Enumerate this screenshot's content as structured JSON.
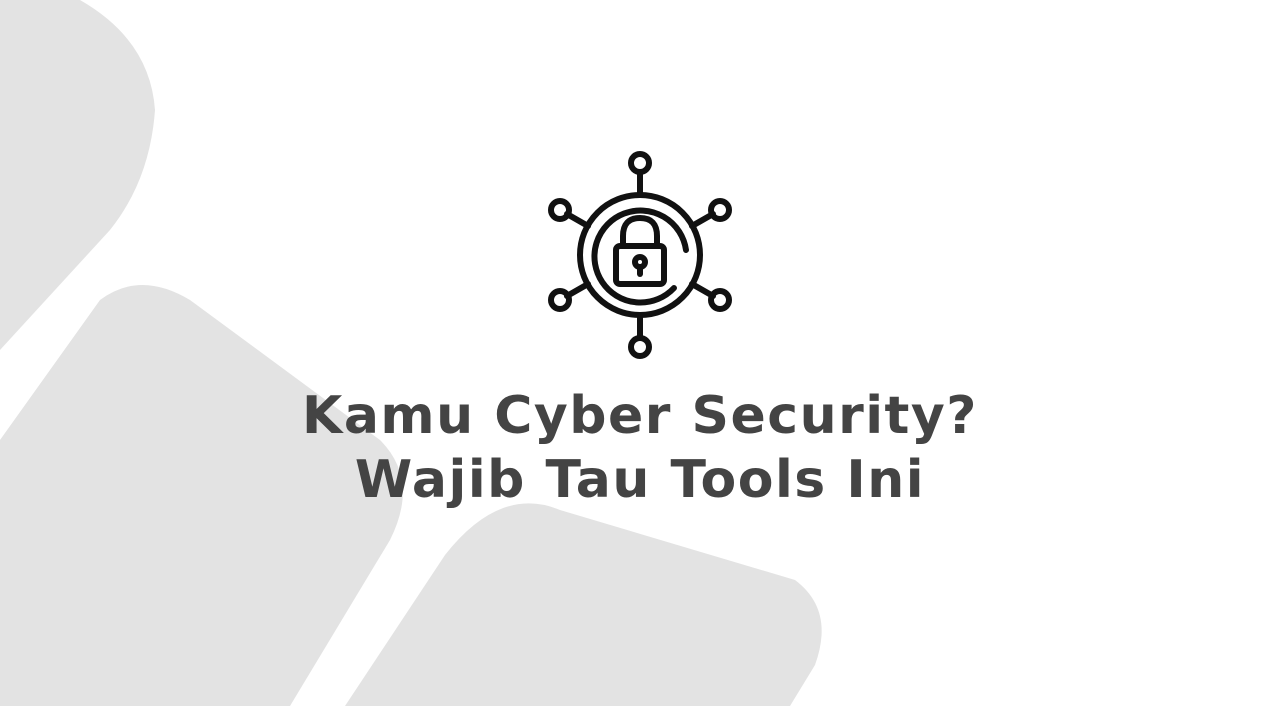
{
  "headline": {
    "line1": "Kamu Cyber Security?",
    "line2": "Wajib Tau Tools Ini"
  },
  "icon": "network-lock-icon",
  "colors": {
    "background": "#ffffff",
    "shape": "#e3e3e3",
    "text": "#444444",
    "icon": "#111111"
  }
}
